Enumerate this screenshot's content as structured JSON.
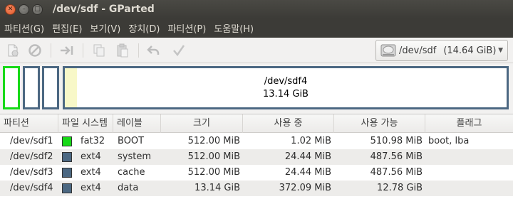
{
  "window": {
    "title": "/dev/sdf - GParted"
  },
  "menu": [
    "파티션(G)",
    "편집(E)",
    "보기(V)",
    "장치(D)",
    "파티션(P)",
    "도움말(H)"
  ],
  "toolbar": {
    "buttons": [
      "new-icon",
      "delete-icon",
      "resize-move-icon",
      "copy-icon",
      "paste-icon",
      "undo-icon",
      "apply-icon"
    ],
    "device": {
      "name": "/dev/sdf",
      "size": "(14.64 GiB)"
    }
  },
  "map": {
    "selected": {
      "name": "/dev/sdf4",
      "size": "13.14 GiB",
      "used_fraction": 0.028
    },
    "colors": {
      "fat32": "#18d918",
      "ext4": "#4c6882",
      "used": "#f8f8c8"
    }
  },
  "table": {
    "headers": [
      "파티션",
      "파일 시스템",
      "레이블",
      "크기",
      "사용 중",
      "사용 가능",
      "플래그"
    ],
    "rows": [
      {
        "partition": "/dev/sdf1",
        "fs": "fat32",
        "fs_color": "#18d918",
        "label": "BOOT",
        "size": "512.00 MiB",
        "used": "1.02 MiB",
        "free": "510.98 MiB",
        "flags": "boot, lba"
      },
      {
        "partition": "/dev/sdf2",
        "fs": "ext4",
        "fs_color": "#4c6882",
        "label": "system",
        "size": "512.00 MiB",
        "used": "24.44 MiB",
        "free": "487.56 MiB",
        "flags": ""
      },
      {
        "partition": "/dev/sdf3",
        "fs": "ext4",
        "fs_color": "#4c6882",
        "label": "cache",
        "size": "512.00 MiB",
        "used": "24.44 MiB",
        "free": "487.56 MiB",
        "flags": ""
      },
      {
        "partition": "/dev/sdf4",
        "fs": "ext4",
        "fs_color": "#4c6882",
        "label": "data",
        "size": "13.14 GiB",
        "used": "372.09 MiB",
        "free": "12.78 GiB",
        "flags": ""
      }
    ]
  }
}
